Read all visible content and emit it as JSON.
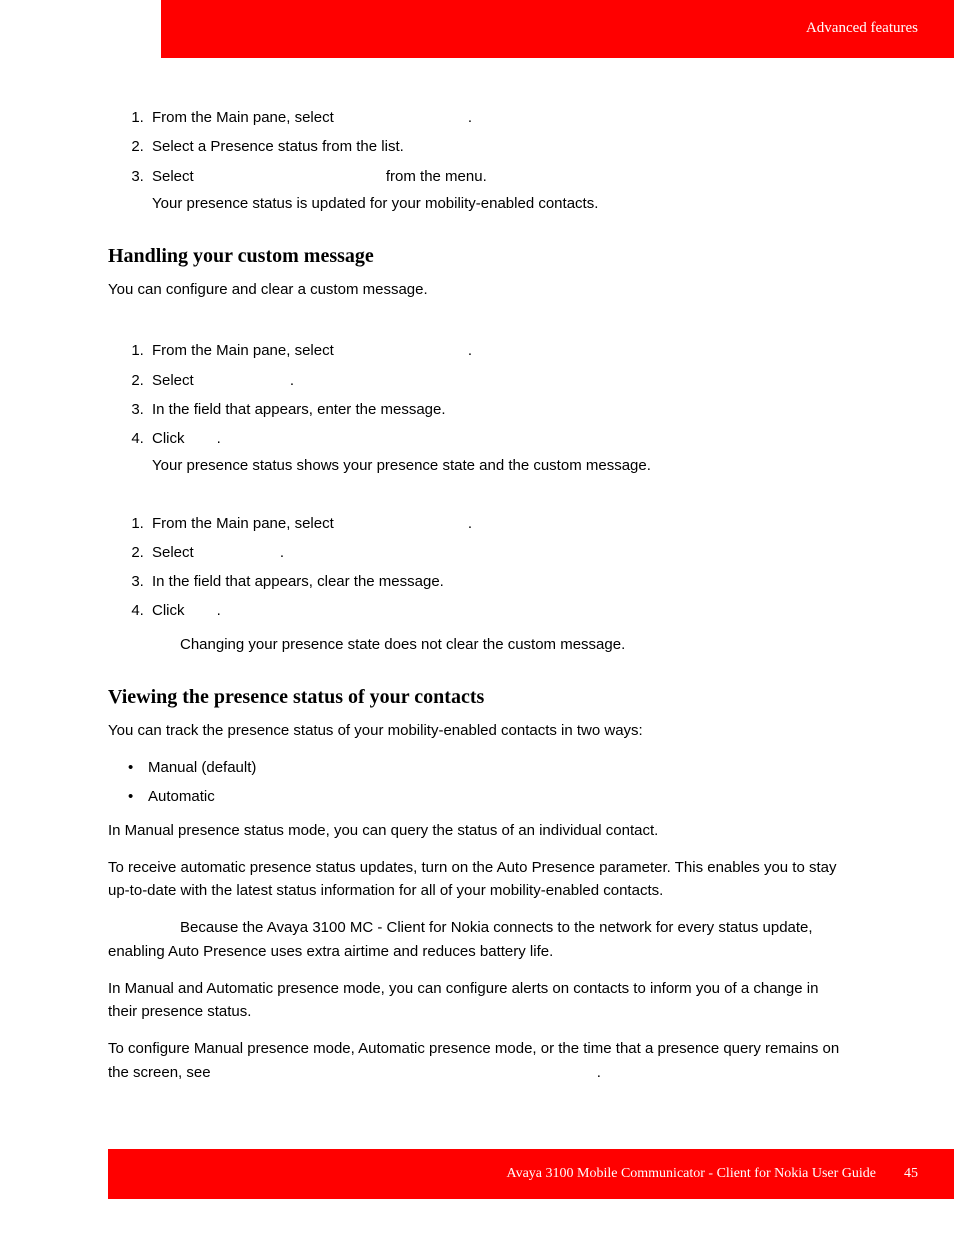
{
  "header": {
    "section": "Advanced features"
  },
  "s1": {
    "step1a": "From the Main pane, select ",
    "step1b": ".",
    "step2": "Select a Presence status from the list.",
    "step3a": "Select ",
    "step3b": "from the menu.",
    "result": "Your presence status is updated for your mobility-enabled contacts."
  },
  "h_custom": "Handling your custom message",
  "custom_intro": "You can configure and clear a custom message.",
  "s2": {
    "step1a": "From the Main pane, select ",
    "step1b": ".",
    "step2a": "Select ",
    "step2b": ".",
    "step3": "In the field that appears, enter the message.",
    "step4a": "Click ",
    "step4b": ".",
    "result": "Your presence status shows your presence state and the custom message."
  },
  "s3": {
    "step1a": "From the Main pane, select ",
    "step1b": ".",
    "step2a": "Select ",
    "step2b": ".",
    "step3": "In the field that appears, clear the message.",
    "step4a": "Click ",
    "step4b": ".",
    "note": "Changing your presence state does not clear the custom message."
  },
  "h_view": "Viewing the presence status of your contacts",
  "view_intro": "You can track the presence status of your mobility-enabled contacts in two ways:",
  "modes": {
    "manual": "Manual (default)",
    "auto": "Automatic"
  },
  "view_p1": "In Manual presence status mode, you can query the status of an individual contact.",
  "view_p2": "To receive automatic presence status updates, turn on the Auto Presence parameter. This enables you to stay up-to-date with the latest status information for all of your mobility-enabled contacts.",
  "view_p3": "Because the Avaya 3100 MC - Client for Nokia connects to the network for every status update, enabling Auto Presence uses extra airtime and reduces battery life.",
  "view_p4": "In Manual and Automatic presence mode, you can configure alerts on contacts to inform you of a change in their presence status.",
  "view_p5a": "To configure Manual presence mode, Automatic presence mode, or the time that a presence query remains on the screen, see ",
  "view_p5b": ".",
  "footer": {
    "title": "Avaya 3100 Mobile Communicator - Client for Nokia User Guide",
    "page": "45"
  }
}
